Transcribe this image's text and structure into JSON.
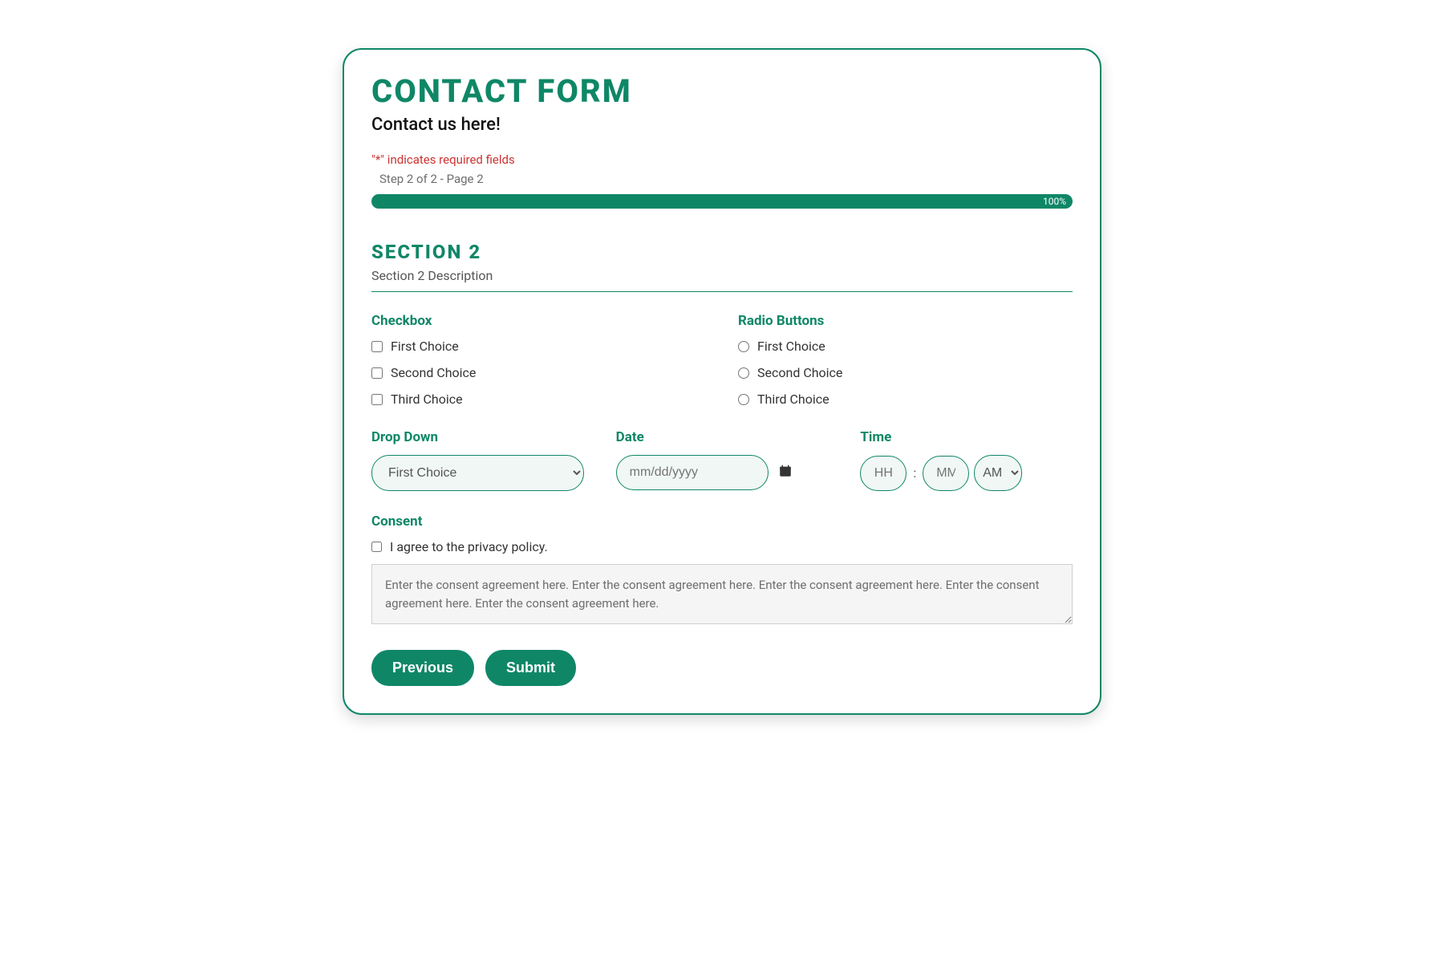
{
  "form": {
    "title": "CONTACT FORM",
    "subtitle": "Contact us here!",
    "required_note_prefix": "\"",
    "required_asterisk": "*",
    "required_note_suffix": "\" indicates required fields",
    "step_text": "Step 2 of 2 - Page 2",
    "progress_percent_label": "100%"
  },
  "section": {
    "title": "SECTION 2",
    "description": "Section 2 Description"
  },
  "checkbox_field": {
    "label": "Checkbox",
    "options": [
      "First Choice",
      "Second Choice",
      "Third Choice"
    ]
  },
  "radio_field": {
    "label": "Radio Buttons",
    "options": [
      "First Choice",
      "Second Choice",
      "Third Choice"
    ]
  },
  "dropdown_field": {
    "label": "Drop Down",
    "selected": "First Choice"
  },
  "date_field": {
    "label": "Date",
    "placeholder": "mm/dd/yyyy"
  },
  "time_field": {
    "label": "Time",
    "hour_placeholder": "HH",
    "minute_placeholder": "MM",
    "ampm": "AM"
  },
  "consent_field": {
    "label": "Consent",
    "checkbox_text": "I agree to the privacy policy.",
    "textarea_value": "Enter the consent agreement here. Enter the consent agreement here. Enter the consent agreement here. Enter the consent agreement here. Enter the consent agreement here."
  },
  "buttons": {
    "previous": "Previous",
    "submit": "Submit"
  }
}
